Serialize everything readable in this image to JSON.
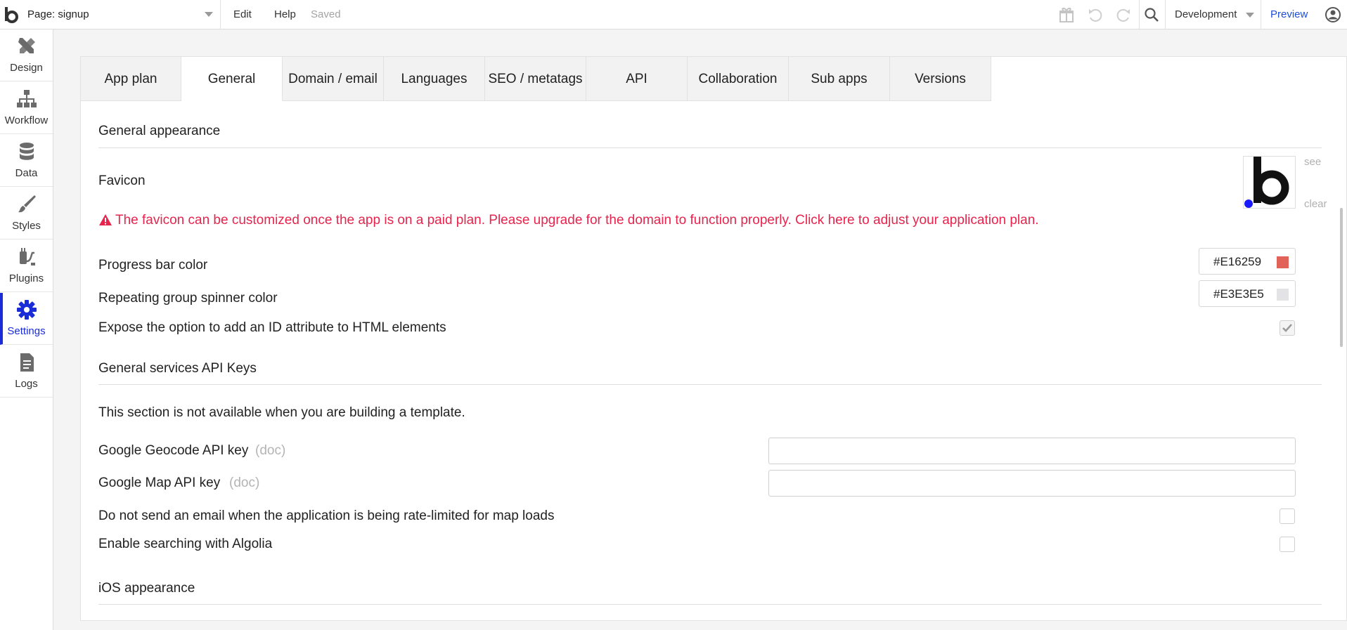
{
  "topbar": {
    "page_select": "Page: signup",
    "menu": {
      "edit": "Edit",
      "help": "Help"
    },
    "status": "Saved",
    "environment": "Development",
    "preview": "Preview",
    "icons": [
      "gift-icon",
      "undo-icon",
      "redo-icon",
      "search-icon",
      "user-account-icon"
    ]
  },
  "sidebar": {
    "items": [
      {
        "label": "Design",
        "icon": "design-tools-icon"
      },
      {
        "label": "Workflow",
        "icon": "workflow-tree-icon"
      },
      {
        "label": "Data",
        "icon": "database-icon"
      },
      {
        "label": "Styles",
        "icon": "paintbrush-icon"
      },
      {
        "label": "Plugins",
        "icon": "plugin-plug-icon"
      },
      {
        "label": "Settings",
        "icon": "gear-icon"
      },
      {
        "label": "Logs",
        "icon": "document-icon"
      }
    ],
    "active": "Settings"
  },
  "tabs": [
    "App plan",
    "General",
    "Domain / email",
    "Languages",
    "SEO / metatags",
    "API",
    "Collaboration",
    "Sub apps",
    "Versions"
  ],
  "active_tab": "General",
  "general": {
    "section_appearance": "General appearance",
    "favicon_label": "Favicon",
    "favicon_see": "see",
    "favicon_clear": "clear",
    "favicon_warning": "The favicon can be customized once the app is on a paid plan. Please upgrade for the domain to function properly. Click here to adjust your application plan.",
    "progress_bar_label": "Progress bar color",
    "progress_bar_value": "#E16259",
    "spinner_label": "Repeating group spinner color",
    "spinner_value": "#E3E3E5",
    "id_attribute_label": "Expose the option to add an ID attribute to HTML elements",
    "id_attribute_checked": true,
    "section_api_keys": "General services API Keys",
    "template_notice": "This section is not available when you are building a template.",
    "geocode_label": "Google Geocode API key",
    "geocode_doc": "(doc)",
    "geocode_value": "",
    "map_label": "Google Map API key",
    "map_doc": "(doc)",
    "map_value": "",
    "rate_limit_label": "Do not send an email when the application is being rate-limited for map loads",
    "rate_limit_checked": false,
    "algolia_label": "Enable searching with Algolia",
    "algolia_checked": false,
    "section_ios": "iOS appearance"
  },
  "colors": {
    "accent_blue": "#1A2CD8",
    "warning_red": "#E8234C",
    "preview_link": "#1E4FD6"
  }
}
